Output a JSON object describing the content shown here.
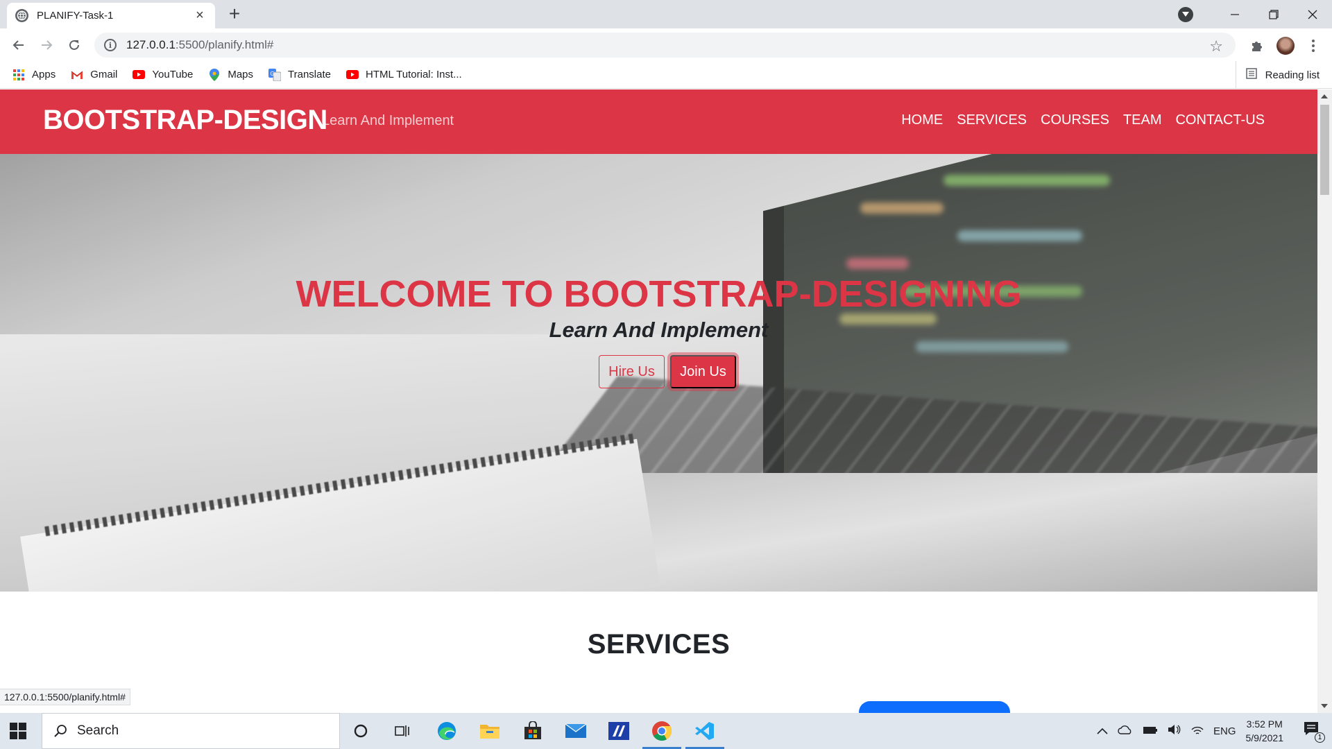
{
  "browser": {
    "tab_title": "PLANIFY-Task-1",
    "url_host": "127.0.0.1",
    "url_rest": ":5500/planify.html#",
    "status_url": "127.0.0.1:5500/planify.html#"
  },
  "bookmarks": [
    {
      "label": "Apps",
      "icon": "apps-grid-icon"
    },
    {
      "label": "Gmail",
      "icon": "gmail-icon"
    },
    {
      "label": "YouTube",
      "icon": "youtube-icon"
    },
    {
      "label": "Maps",
      "icon": "maps-icon"
    },
    {
      "label": "Translate",
      "icon": "translate-icon"
    },
    {
      "label": "HTML Tutorial: Inst...",
      "icon": "youtube-icon"
    }
  ],
  "reading_list": "Reading list",
  "site": {
    "brand": "BOOTSTRAP-DESIGN",
    "brand_sub": "Learn And Implement",
    "menu": [
      "HOME",
      "SERVICES",
      "COURSES",
      "TEAM",
      "CONTACT-US"
    ],
    "hero_title": "WELCOME TO BOOTSTRAP-DESIGNING",
    "hero_sub": "Learn And Implement",
    "hire_label": "Hire Us",
    "join_label": "Join Us",
    "section_title": "SERVICES",
    "accent_color": "#dc3545"
  },
  "taskbar": {
    "search_placeholder": "Search",
    "language": "ENG",
    "time": "3:52 PM",
    "date": "5/9/2021",
    "notification_count": "1"
  }
}
